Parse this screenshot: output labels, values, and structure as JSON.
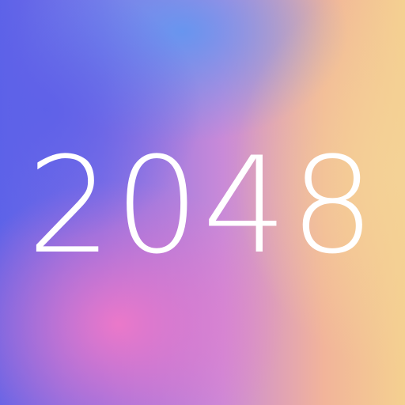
{
  "app": {
    "title": "2048"
  },
  "colors": {
    "text": "#ffffff",
    "gradient_blue": "#5d63e8",
    "gradient_pink": "#f078c8",
    "gradient_peach": "#f4d090"
  }
}
